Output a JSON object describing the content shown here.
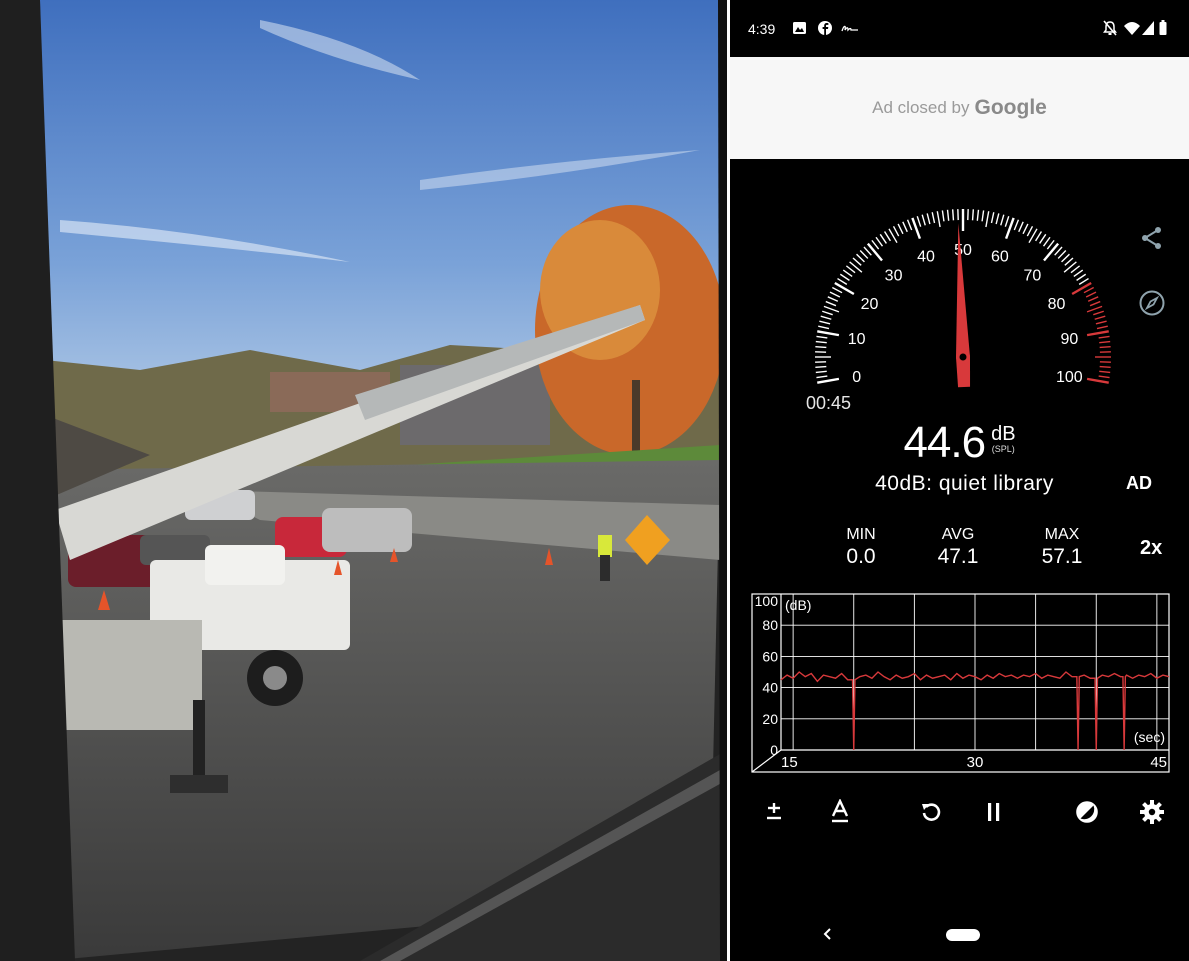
{
  "status_bar": {
    "time": "4:39",
    "icons": [
      "image-notification-icon",
      "facebook-icon",
      "signature-notification-icon",
      "mute-bell-icon",
      "wifi-icon",
      "signal-icon",
      "battery-icon"
    ]
  },
  "ad_banner": {
    "text": "Ad closed by",
    "brand": "Google"
  },
  "gauge": {
    "ticks": [
      "0",
      "10",
      "20",
      "30",
      "40",
      "50",
      "60",
      "70",
      "80",
      "90",
      "100"
    ],
    "needle_value": 49,
    "red_zone_start": 80,
    "elapsed": "00:45",
    "accent_color": "#d8393b"
  },
  "reading": {
    "value": "44.6",
    "unit": "dB",
    "weighting": "(SPL)",
    "reference": "40dB: quiet library"
  },
  "toggles": {
    "ad": "AD",
    "speed": "2x"
  },
  "stats": {
    "min_label": "MIN",
    "min_value": "0.0",
    "avg_label": "AVG",
    "avg_value": "47.1",
    "max_label": "MAX",
    "max_value": "57.1"
  },
  "chart_data": {
    "type": "line",
    "ylabel": "(dB)",
    "xlabel": "(sec)",
    "ylim": [
      0,
      100
    ],
    "xlim": [
      14,
      46
    ],
    "y_ticks": [
      "100",
      "80",
      "60",
      "40",
      "20",
      "0"
    ],
    "x_ticks": [
      "15",
      "30",
      "45"
    ],
    "grid": true,
    "line_color": "#d8393b",
    "series": [
      {
        "x": [
          14.0,
          14.5,
          15.0,
          15.5,
          16.0,
          16.5,
          17.0,
          17.5,
          18.0,
          18.5,
          19.0,
          19.5,
          19.9,
          20.0,
          20.1,
          20.5,
          21.0,
          21.5,
          22.0,
          22.5,
          23.0,
          23.5,
          24.0,
          24.5,
          25.0,
          25.5,
          26.0,
          26.5,
          27.0,
          27.5,
          28.0,
          28.5,
          29.0,
          29.5,
          30.0,
          30.5,
          31.0,
          31.5,
          32.0,
          32.5,
          33.0,
          33.5,
          34.0,
          34.5,
          35.0,
          35.5,
          36.0,
          36.5,
          37.0,
          37.5,
          38.0,
          38.4,
          38.5,
          38.6,
          39.0,
          39.5,
          39.9,
          40.0,
          40.1,
          40.5,
          41.0,
          41.5,
          42.0,
          42.2,
          42.3,
          42.4,
          42.5,
          43.0,
          43.5,
          44.0,
          44.5,
          45.0,
          45.5,
          46.0
        ],
        "y": [
          45,
          48,
          46,
          50,
          47,
          49,
          44,
          48,
          47,
          46,
          49,
          45,
          45,
          0,
          45,
          47,
          48,
          46,
          50,
          47,
          45,
          48,
          46,
          47,
          49,
          45,
          48,
          46,
          47,
          48,
          45,
          49,
          46,
          48,
          47,
          45,
          48,
          46,
          49,
          47,
          48,
          46,
          48,
          47,
          49,
          46,
          48,
          47,
          46,
          50,
          47,
          47,
          0,
          47,
          48,
          46,
          46,
          0,
          46,
          48,
          47,
          49,
          47,
          47,
          0,
          47,
          48,
          46,
          48,
          47,
          49,
          46,
          48,
          47
        ]
      }
    ]
  }
}
